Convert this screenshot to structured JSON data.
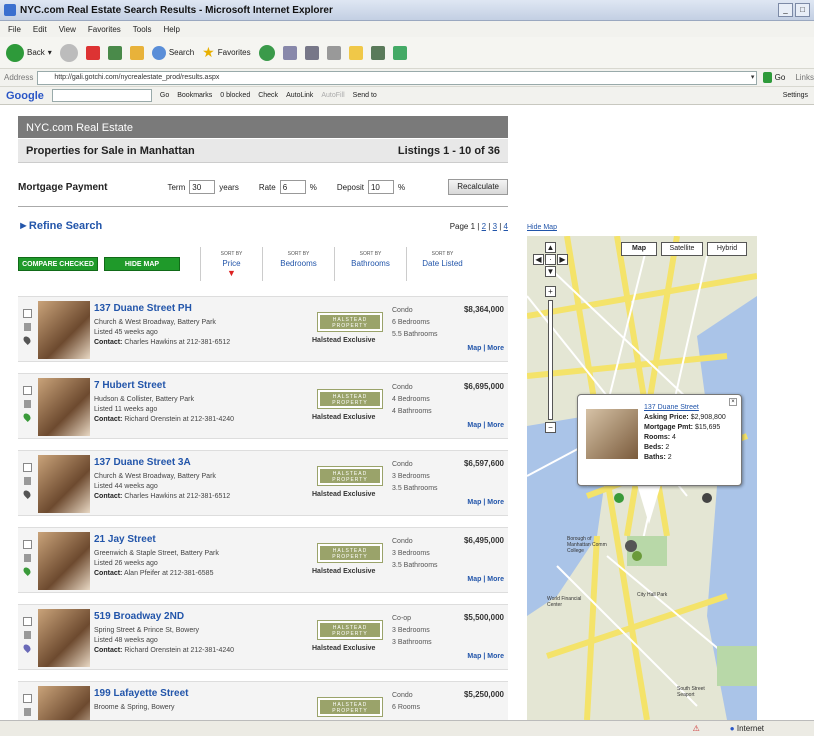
{
  "window": {
    "title": "NYC.com Real Estate Search Results - Microsoft Internet Explorer"
  },
  "menu": [
    "File",
    "Edit",
    "View",
    "Favorites",
    "Tools",
    "Help"
  ],
  "toolbar": {
    "back": "Back",
    "search": "Search",
    "favorites": "Favorites"
  },
  "address": {
    "label": "Address",
    "url": "http://gali.gotchi.com/nycrealestate_prod/results.aspx",
    "go": "Go",
    "links": "Links"
  },
  "googlebar": {
    "logo": "Google",
    "go": "Go",
    "bookmarks": "Bookmarks",
    "blocked": "0 blocked",
    "check": "Check",
    "autolink": "AutoLink",
    "autofill": "AutoFill",
    "sendto": "Send to",
    "settings": "Settings"
  },
  "page": {
    "site_header": "NYC.com Real Estate",
    "subheader": "Properties for Sale in Manhattan",
    "listings_count": "Listings 1 - 10 of 36",
    "mortgage": {
      "label": "Mortgage Payment",
      "term_label": "Term",
      "term_value": "30",
      "term_unit": "years",
      "rate_label": "Rate",
      "rate_value": "6",
      "rate_unit": "%",
      "deposit_label": "Deposit",
      "deposit_value": "10",
      "deposit_unit": "%",
      "recalc": "Recalculate"
    },
    "refine": "Refine Search",
    "pager": {
      "label": "Page 1 |",
      "pages": [
        "2",
        "3",
        "4"
      ]
    },
    "compare_btn": "COMPARE CHECKED",
    "hide_map_btn": "HIDE MAP",
    "sort_label": "SORT BY",
    "sort_cols": [
      "Price",
      "Bedrooms",
      "Bathrooms",
      "Date Listed"
    ],
    "logo_text": "HALSTEAD PROPERTY",
    "exclusive": "Halstead Exclusive",
    "map_link": "Map",
    "more_link": "More",
    "listings": [
      {
        "title": "137 Duane Street PH",
        "location": "Church & West Broadway, Battery Park",
        "listed": "Listed 45 weeks ago",
        "contact_label": "Contact:",
        "contact": "Charles Hawkins at 212-381-6512",
        "type": "Condo",
        "rooms": "6 Bedrooms",
        "baths": "5.5 Bathrooms",
        "price": "$8,364,000",
        "pin": "#555"
      },
      {
        "title": "7 Hubert Street",
        "location": "Hudson & Collister, Battery Park",
        "listed": "Listed 11 weeks ago",
        "contact_label": "Contact:",
        "contact": "Richard Orenstein at 212-381-4240",
        "type": "Condo",
        "rooms": "4 Bedrooms",
        "baths": "4 Bathrooms",
        "price": "$6,695,000",
        "pin": "#3a9a3a"
      },
      {
        "title": "137 Duane Street 3A",
        "location": "Church & West Broadway, Battery Park",
        "listed": "Listed 44 weeks ago",
        "contact_label": "Contact:",
        "contact": "Charles Hawkins at 212-381-6512",
        "type": "Condo",
        "rooms": "3 Bedrooms",
        "baths": "3.5 Bathrooms",
        "price": "$6,597,600",
        "pin": "#555"
      },
      {
        "title": "21 Jay Street",
        "location": "Greenwich & Staple Street, Battery Park",
        "listed": "Listed 26 weeks ago",
        "contact_label": "Contact:",
        "contact": "Alan Pfeifer at 212-381-6585",
        "type": "Condo",
        "rooms": "3 Bedrooms",
        "baths": "3.5 Bathrooms",
        "price": "$6,495,000",
        "pin": "#3a9a3a"
      },
      {
        "title": "519 Broadway 2ND",
        "location": "Spring Street & Prince St, Bowery",
        "listed": "Listed 48 weeks ago",
        "contact_label": "Contact:",
        "contact": "Richard Orenstein at 212-381-4240",
        "type": "Co-op",
        "rooms": "3 Bedrooms",
        "baths": "3 Bathrooms",
        "price": "$5,500,000",
        "pin": "#6a6ab8"
      },
      {
        "title": "199 Lafayette Street",
        "location": "Broome & Spring, Bowery",
        "listed": "",
        "contact_label": "",
        "contact": "",
        "type": "Condo",
        "rooms": "6 Rooms",
        "baths": "",
        "price": "$5,250,000",
        "pin": "#555"
      }
    ],
    "map": {
      "hide_map": "Hide Map",
      "btn_map": "Map",
      "btn_satellite": "Satellite",
      "btn_hybrid": "Hybrid",
      "popup": {
        "title": "137 Duane Street",
        "asking_label": "Asking Price:",
        "asking": "$2,908,800",
        "mortgage_label": "Mortgage Pmt:",
        "mortgage": "$15,695",
        "rooms_label": "Rooms:",
        "rooms": "4",
        "beds_label": "Beds:",
        "beds": "2",
        "baths_label": "Baths:",
        "baths": "2"
      },
      "labels": [
        "World Financial Center",
        "City Hall Park",
        "Borough of Manhattan Comm College",
        "South Street Seaport"
      ]
    }
  },
  "status": {
    "zone": "Internet"
  }
}
